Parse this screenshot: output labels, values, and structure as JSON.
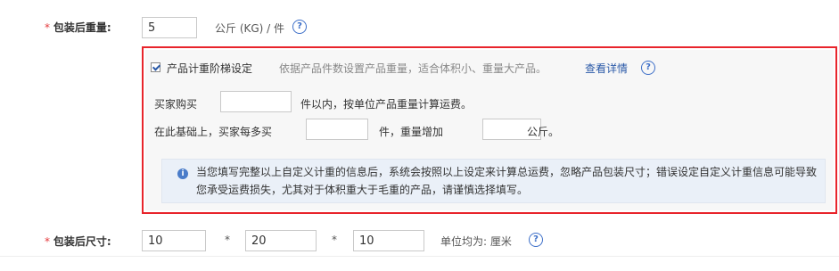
{
  "weight": {
    "required_mark": "*",
    "label": "包装后重量:",
    "value": "5",
    "unit": "公斤 (KG) / 件",
    "help": "?"
  },
  "tiered": {
    "checkbox_label": "产品计重阶梯设定",
    "description": "依据产品件数设置产品重量，适合体积小、重量大产品。",
    "details_link": "查看详情",
    "help": "?",
    "row1_prefix": "买家购买",
    "row1_value": "",
    "row1_suffix": "件以内，按单位产品重量计算运费。",
    "row2_prefix": "在此基础上，买家每多买",
    "row2_value1": "",
    "row2_middle": "件，重量增加",
    "row2_value2": "",
    "row2_suffix": "公斤。",
    "notice_icon": "i",
    "notice_text": "当您填写完整以上自定义计重的信息后，系统会按照以上设定来计算总运费，忽略产品包装尺寸；错误设定自定义计重信息可能导致您承受运费损失，尤其对于体积重大于毛重的产品，请谨慎选择填写。"
  },
  "size": {
    "required_mark": "*",
    "label": "包装后尺寸:",
    "length": "10",
    "width": "20",
    "height": "10",
    "times": "*",
    "unit": "单位均为: 厘米",
    "help": "?"
  },
  "colors": {
    "highlight_border": "#e8242b",
    "link": "#2b5aa8",
    "required": "#e4393c"
  }
}
